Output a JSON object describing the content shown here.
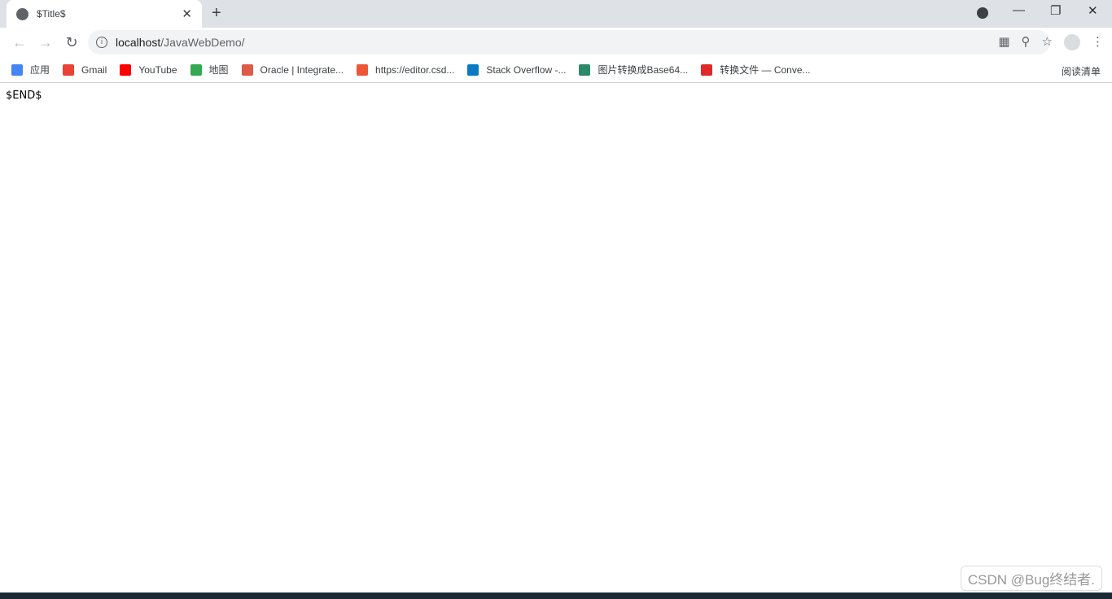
{
  "tab": {
    "title": "$Title$",
    "close": "✕",
    "new_tab": "+"
  },
  "window": {
    "minimize": "—",
    "maximize": "❐",
    "close": "✕"
  },
  "address": {
    "host": "localhost",
    "path": "/JavaWebDemo/"
  },
  "bookmarks": [
    {
      "label": "应用",
      "color": "#4285f4"
    },
    {
      "label": "Gmail",
      "color": "#ea4335"
    },
    {
      "label": "YouTube",
      "color": "#ff0000"
    },
    {
      "label": "地图",
      "color": "#34a853"
    },
    {
      "label": "Oracle | Integrate...",
      "color": "#e05a48"
    },
    {
      "label": "https://editor.csd...",
      "color": "#f05536"
    },
    {
      "label": "Stack Overflow -...",
      "color": "#0a7bc2"
    },
    {
      "label": "图片转换成Base64...",
      "color": "#2a8a6a"
    },
    {
      "label": "转换文件 — Conve...",
      "color": "#e02a2a"
    }
  ],
  "reading_list": "阅读清单",
  "page": {
    "body_text": "$END$"
  },
  "watermark": "CSDN @Bug终结者."
}
